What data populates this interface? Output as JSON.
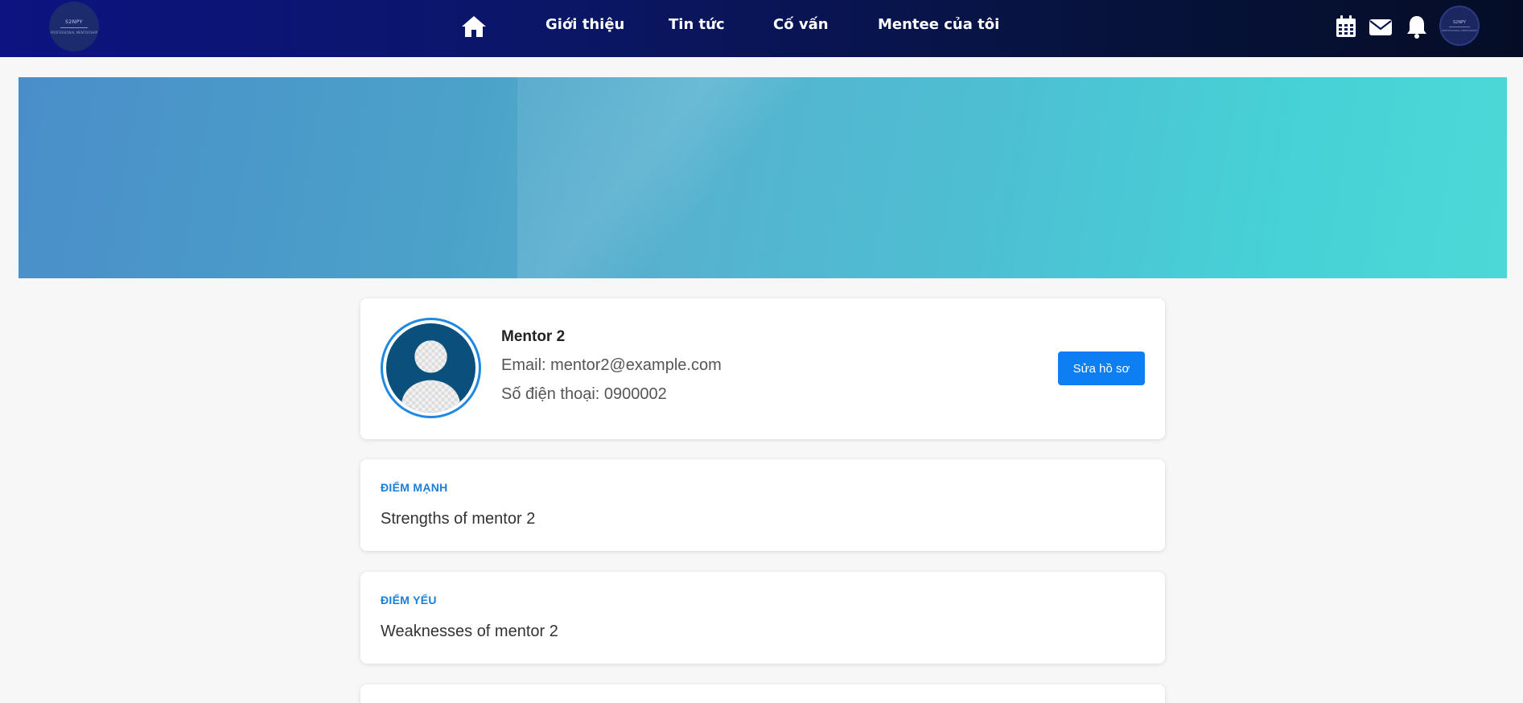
{
  "brand": {
    "logo_text": "S2NPY",
    "logo_sub": "PROFESSIONAL MENTORSHIP",
    "colors": {
      "nav_start": "#0d1380",
      "nav_end": "#050d26",
      "accent": "#0d7ff2",
      "section_title": "#1a7fd9"
    }
  },
  "nav": {
    "home_icon": "home-icon",
    "links": [
      "Giới thiệu",
      "Tin tức",
      "Cố vấn",
      "Mentee của tôi"
    ],
    "right_icons": [
      "calendar-icon",
      "mail-icon",
      "bell-icon"
    ],
    "avatar_text": "S2NPY",
    "avatar_sub": "PROFESSIONAL MENTORSHIP"
  },
  "profile": {
    "name": "Mentor 2",
    "email": "Email: mentor2@example.com",
    "phone": "Số điện thoại: 0900002",
    "edit_label": "Sửa hồ sơ"
  },
  "sections": {
    "strengths": {
      "title": "ĐIỂM MẠNH",
      "text": "Strengths of mentor 2"
    },
    "weaknesses": {
      "title": "ĐIỂM YẾU",
      "text": "Weaknesses of mentor 2"
    }
  }
}
